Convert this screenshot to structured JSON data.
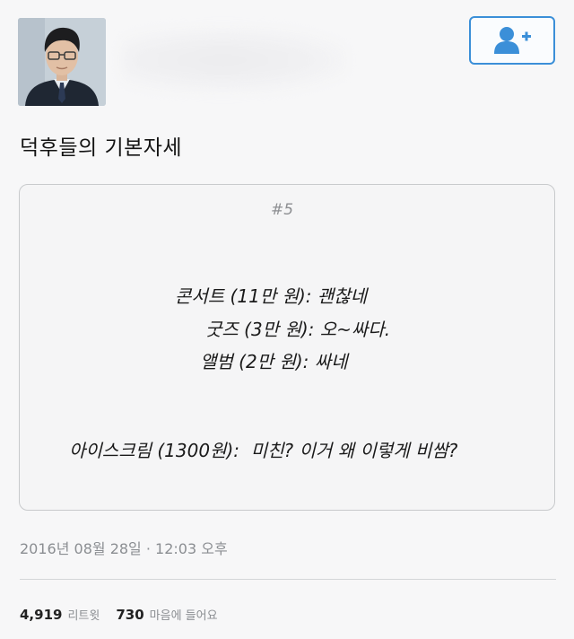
{
  "tweet": {
    "text": "덕후들의 기본자세",
    "timestamp": "2016년 08월 28일 · 12:03 오후"
  },
  "icons": {
    "follow": "add-user-icon",
    "avatar": "profile-photo"
  },
  "colors": {
    "accent": "#3b8fd8",
    "muted_text": "#8b8e92"
  },
  "card": {
    "tag": "#5",
    "lines": [
      "콘서트 (11만 원): 괜찮네",
      "굿즈 (3만 원): 오~싸다.",
      "앨범 (2만 원): 싸네",
      "아이스크림 (1300원):  미친? 이거 왜 이렇게 비쌈?"
    ]
  },
  "stats": {
    "retweets": "4,919",
    "retweets_label": "리트윗",
    "likes": "730",
    "likes_label": "마음에 들어요"
  }
}
